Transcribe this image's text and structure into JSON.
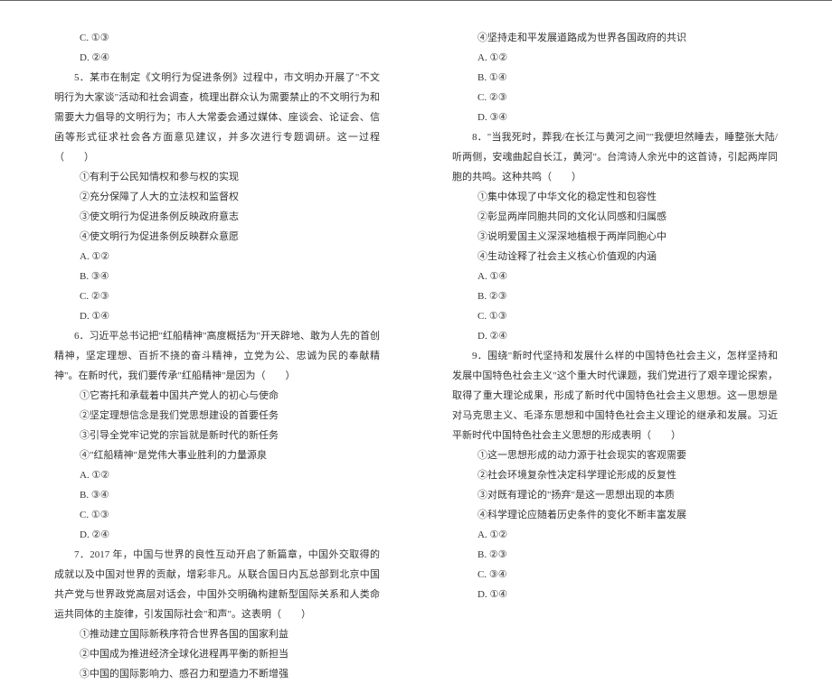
{
  "left": {
    "q4_optC": "C. ①③",
    "q4_optD": "D. ②④",
    "q5_stem1": "5．某市在制定《文明行为促进条例》过程中，市文明办开展了\"不文明行为大家谈\"活动和社会调查，梳理出群众认为需要禁止的不文明行为和需要大力倡导的文明行为；市人大常委会通过媒体、座谈会、论证会、信函等形式征求社会各方面意见建议，并多次进行专题调研。这一过程（　　）",
    "q5_s1": "①有利于公民知情权和参与权的实现",
    "q5_s2": "②充分保障了人大的立法权和监督权",
    "q5_s3": "③使文明行为促进条例反映政府意志",
    "q5_s4": "④使文明行为促进条例反映群众意愿",
    "q5_optA": "A. ①②",
    "q5_optB": "B. ③④",
    "q5_optC": "C. ②③",
    "q5_optD": "D. ①④",
    "q6_stem1": "6．习近平总书记把\"红船精神\"高度概括为\"开天辟地、敢为人先的首创精神，坚定理想、百折不挠的奋斗精神，立党为公、忠诚为民的奉献精神\"。在新时代，我们要传承\"红船精神\"是因为（　　）",
    "q6_s1": "①它寄托和承载着中国共产党人的初心与使命",
    "q6_s2": "②坚定理想信念是我们党思想建设的首要任务",
    "q6_s3": "③引导全党牢记党的宗旨就是新时代的新任务",
    "q6_s4": "④\"红船精神\"是党伟大事业胜利的力量源泉",
    "q6_optA": "A. ①②",
    "q6_optB": "B. ③④",
    "q6_optC": "C. ①③",
    "q6_optD": "D. ②④",
    "q7_stem1": "7．2017 年，中国与世界的良性互动开启了新篇章，中国外交取得的成就以及中国对世界的贡献，增彩非凡。从联合国日内瓦总部到北京中国共产党与世界政党高层对话会，中国外交明确构建新型国际关系和人类命运共同体的主旋律，引发国际社会\"和声\"。这表明（　　）",
    "q7_s1": "①推动建立国际新秩序符合世界各国的国家利益",
    "q7_s2": "②中国成为推进经济全球化进程再平衡的新担当",
    "q7_s3": "③中国的国际影响力、感召力和塑造力不断增强"
  },
  "right": {
    "q7_s4": "④坚持走和平发展道路成为世界各国政府的共识",
    "q7_optA": "A. ①②",
    "q7_optB": "B. ①④",
    "q7_optC": "C. ②③",
    "q7_optD": "D. ③④",
    "q8_stem1": "8．\"当我死时，葬我/在长江与黄河之间\"\"我便坦然睡去，睡整张大陆/听两侧，安魂曲起自长江，黄河\"。台湾诗人余光中的这首诗，引起两岸同胞的共鸣。这种共鸣（　　）",
    "q8_s1": "①集中体现了中华文化的稳定性和包容性",
    "q8_s2": "②彰显两岸同胞共同的文化认同感和归属感",
    "q8_s3": "③说明爱国主义深深地植根于两岸同胞心中",
    "q8_s4": "④生动诠释了社会主义核心价值观的内涵",
    "q8_optA": "A. ①④",
    "q8_optB": "B. ②③",
    "q8_optC": "C. ①③",
    "q8_optD": "D. ②④",
    "q9_stem1": "9．围绕\"新时代坚持和发展什么样的中国特色社会主义，怎样坚持和发展中国特色社会主义\"这个重大时代课题，我们党进行了艰辛理论探索，取得了重大理论成果，形成了新时代中国特色社会主义思想。这一思想是对马克思主义、毛泽东思想和中国特色社会主义理论的继承和发展。习近平新时代中国特色社会主义思想的形成表明（　　）",
    "q9_s1": "①这一思想形成的动力源于社会现实的客观需要",
    "q9_s2": "②社会环境复杂性决定科学理论形成的反复性",
    "q9_s3": "③对既有理论的\"扬弃\"是这一思想出现的本质",
    "q9_s4": "④科学理论应随着历史条件的变化不断丰富发展",
    "q9_optA": "A. ①②",
    "q9_optB": "B. ②③",
    "q9_optC": "C. ③④",
    "q9_optD": "D. ①④"
  }
}
